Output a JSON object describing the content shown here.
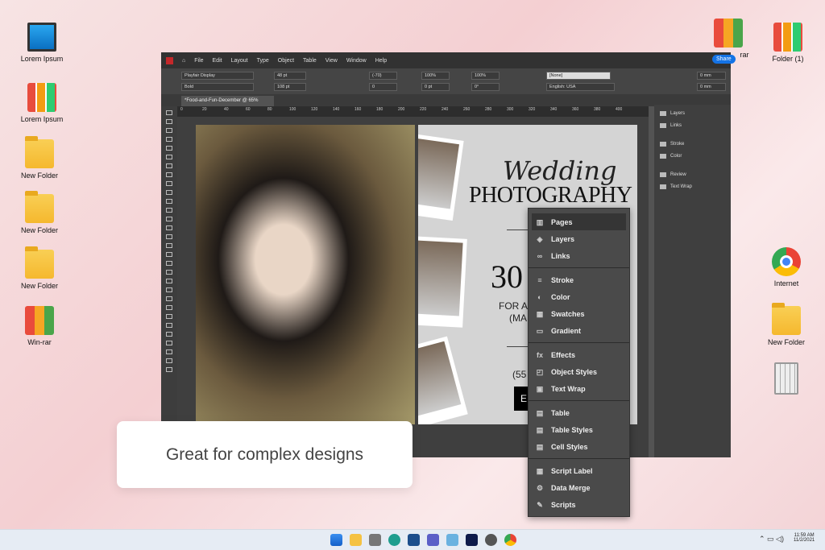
{
  "desktop": {
    "left_icons": [
      "Lorem Ipsum",
      "Lorem Ipsum",
      "New Folder",
      "New Folder",
      "New Folder",
      "Win-rar"
    ],
    "right_icons": [
      "rar",
      "Folder (1)",
      "Internet",
      "New Folder"
    ]
  },
  "app": {
    "menu": [
      "File",
      "Edit",
      "Layout",
      "Type",
      "Object",
      "Table",
      "View",
      "Window",
      "Help"
    ],
    "share": "Share",
    "font": "Playfair Display",
    "style": "Bold",
    "size": "48 pt",
    "leading": "108 pt",
    "kerning": "(-70)",
    "tracking": "0",
    "vscale": "100%",
    "hscale": "100%",
    "baseline": "0 pt",
    "skew": "0°",
    "char_style": "[None]",
    "language": "English: USA",
    "indent1": "0 mm",
    "indent2": "0 mm",
    "tab": "*Food-and-Fun-December @ 65%",
    "ruler": [
      "0",
      "20",
      "40",
      "60",
      "80",
      "100",
      "120",
      "140",
      "160",
      "180",
      "200",
      "220",
      "240",
      "260",
      "280",
      "300",
      "320",
      "340",
      "360",
      "380",
      "400"
    ]
  },
  "doc": {
    "title_script": "Wedding",
    "title": "PHOTOGRAPHY",
    "big": "30",
    "line1": "FOR A",
    "line2": "(MA",
    "phone": "(55",
    "btn": "E"
  },
  "right_panel": [
    "Layers",
    "Links",
    "Stroke",
    "Color",
    "Review",
    "Text Wrap"
  ],
  "float_panel": [
    [
      "Pages",
      "Layers",
      "Links"
    ],
    [
      "Stroke",
      "Color",
      "Swatches",
      "Gradient"
    ],
    [
      "Effects",
      "Object Styles",
      "Text Wrap"
    ],
    [
      "Table",
      "Table Styles",
      "Cell Styles"
    ],
    [
      "Script Label",
      "Data Merge",
      "Scripts"
    ]
  ],
  "callout": "Great for complex designs",
  "taskbar": {
    "time": "11:59 AM",
    "date": "11/2/2021"
  }
}
